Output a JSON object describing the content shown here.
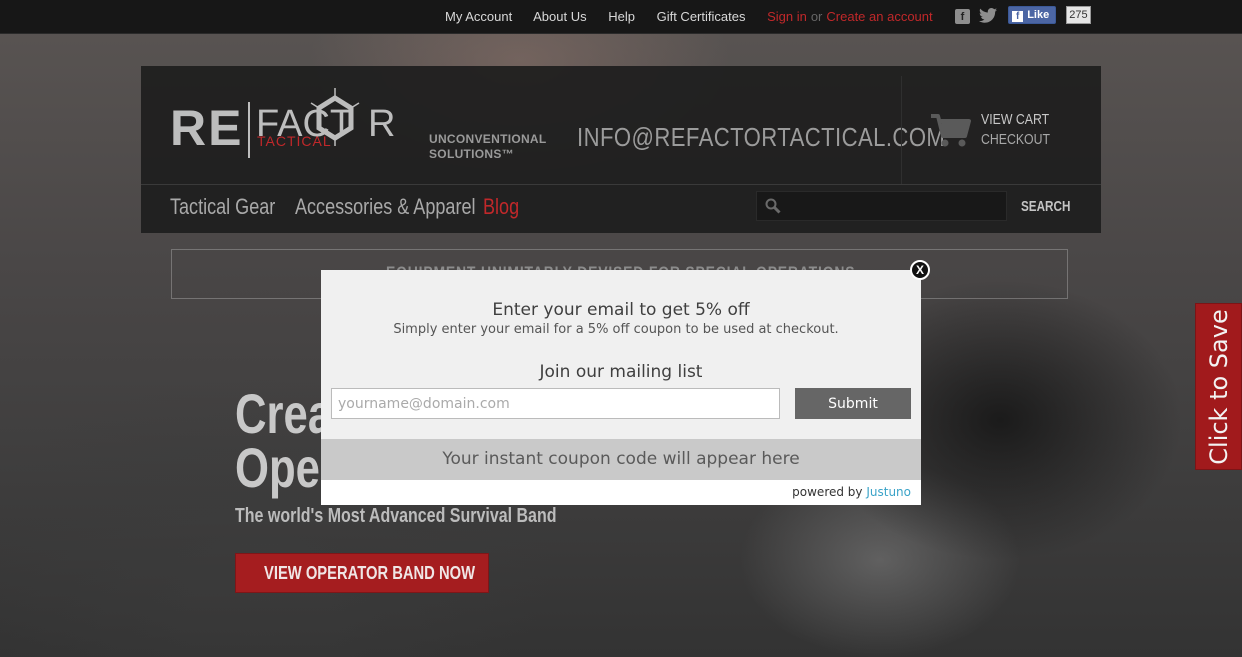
{
  "topbar": {
    "links": [
      "My Account",
      "About Us",
      "Help",
      "Gift Certificates"
    ],
    "sign_in": "Sign in",
    "or": "or",
    "create_account": "Create an account",
    "facebook_glyph": "f",
    "like_label": "Like",
    "like_count": "275"
  },
  "header": {
    "logo": {
      "re": "RE",
      "fact": "FACT",
      "r": "R",
      "tactical": "TACTICAL"
    },
    "tagline_line1": "UNCONVENTIONAL",
    "tagline_line2": "SOLUTIONS™",
    "email": "INFO@REFACTORTACTICAL.COM",
    "cart": {
      "view": "VIEW CART",
      "checkout": "CHECKOUT"
    },
    "nav": [
      "Tactical Gear",
      "Accessories & Apparel",
      "Blog"
    ],
    "search": {
      "placeholder": "",
      "button": "SEARCH"
    }
  },
  "banner": {
    "text": "EQUIPMENT UNIMITABLY DEVISED FOR SPECIAL OPERATIONS"
  },
  "hero": {
    "line1": "Crea",
    "line2": "Oper",
    "subtitle": "The world's Most Advanced Survival Band",
    "cta": "VIEW OPERATOR BAND NOW"
  },
  "save_tab": {
    "label": "Click to Save"
  },
  "modal": {
    "close": "X",
    "title": "Enter your email to get 5% off",
    "subtitle": "Simply enter your email for a 5% off coupon to be used at checkout.",
    "join": "Join our mailing list",
    "email_placeholder": "yourname@domain.com",
    "submit": "Submit",
    "coupon_text": "Your instant coupon code will appear here",
    "powered_by": "powered by",
    "brand": "Justuno"
  },
  "colors": {
    "accent_red": "#c0282a",
    "button_red": "#a51d1f",
    "justuno_blue": "#3aa3c8"
  }
}
